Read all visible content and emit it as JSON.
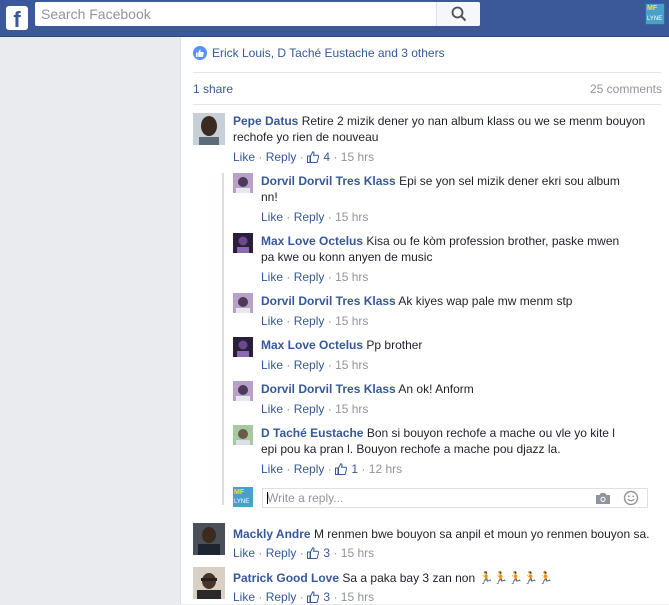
{
  "header": {
    "logo": "f",
    "search_placeholder": "Search Facebook",
    "avatar_text_top": "MF",
    "avatar_text_bottom": "LYNE"
  },
  "post": {
    "likers": "Erick Louis, D Taché Eustache and 3 others",
    "shares": "1 share",
    "comments_count": "25 comments"
  },
  "actions": {
    "like": "Like",
    "reply": "Reply",
    "sep": "·"
  },
  "comments": [
    {
      "name": "Pepe Datus",
      "text": "Retire 2 mizik dener yo nan album klass ou we se menm bouyon rechofe yo rien de nouveau",
      "likes": "4",
      "time": "15 hrs"
    },
    {
      "name": "Dorvil Dorvil Tres Klass",
      "text": "Epi se yon sel mizik dener ekri sou album nn!",
      "likes": "",
      "time": "15 hrs"
    },
    {
      "name": "Max Love Octelus",
      "text": "Kisa ou fe kòm profession brother, paske mwen pa kwe ou konn anyen de music",
      "likes": "",
      "time": "15 hrs"
    },
    {
      "name": "Dorvil Dorvil Tres Klass",
      "text": "Ak kiyes wap pale mw menm stp",
      "likes": "",
      "time": "15 hrs"
    },
    {
      "name": "Max Love Octelus",
      "text": "Pp brother",
      "likes": "",
      "time": "15 hrs"
    },
    {
      "name": "Dorvil Dorvil Tres Klass",
      "text": "An ok! Anform",
      "likes": "",
      "time": "15 hrs"
    },
    {
      "name": "D Taché Eustache",
      "text": "Bon si bouyon rechofe a mache ou vle yo kite l epi pou ka pran l. Bouyon rechofe a mache pou djazz la.",
      "likes": "1",
      "time": "12 hrs"
    },
    {
      "name": "Mackly Andre",
      "text": "M renmen bwe bouyon sa anpil et moun yo renmen bouyon sa.",
      "likes": "3",
      "time": "15 hrs"
    },
    {
      "name": "Patrick Good Love",
      "text": "Sa a paka bay 3 zan non 🏃🏃🏃🏃🏃",
      "likes": "3",
      "time": "15 hrs"
    }
  ],
  "reply_box": {
    "placeholder": "Write a reply..."
  },
  "colors": {
    "brand": "#3b5998",
    "link": "#365899",
    "muted": "#90949c",
    "like_blue": "#5890ff"
  }
}
